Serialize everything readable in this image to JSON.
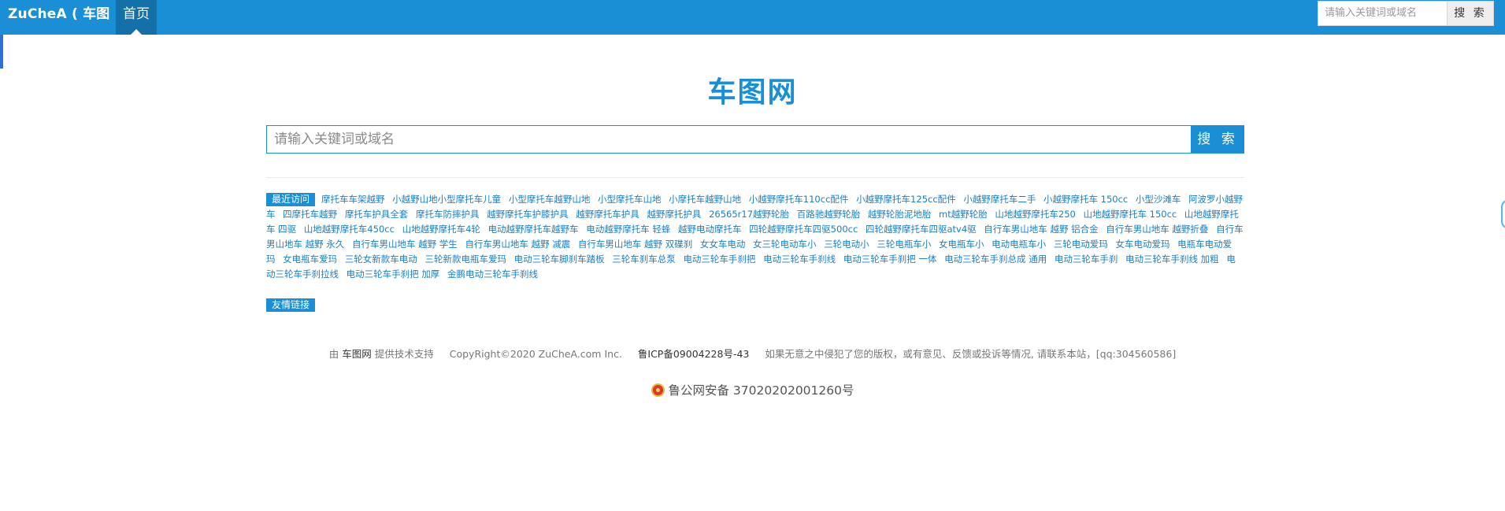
{
  "navbar": {
    "brand": "ZuCheA ( 车图 )",
    "home_label": "首页",
    "search_placeholder": "请输入关键词或域名",
    "search_button": "搜 索"
  },
  "main": {
    "title": "车图网",
    "search_placeholder": "请输入关键词或域名",
    "search_button": "搜 索"
  },
  "recent": {
    "label": "最近访问",
    "links": [
      "摩托车车架越野",
      "小越野山地小型摩托车儿童",
      "小型摩托车越野山地",
      "小型摩托车山地",
      "小摩托车越野山地",
      "小越野摩托车110cc配件",
      "小越野摩托车125cc配件",
      "小越野摩托车二手",
      "小越野摩托车 150cc",
      "小型沙滩车",
      "阿波罗小越野车",
      "四摩托车越野",
      "摩托车护具全套",
      "摩托车防摔护具",
      "越野摩托车护膝护具",
      "越野摩托车护具",
      "越野摩托护具",
      "26565r17越野轮胎",
      "百路驰越野轮胎",
      "越野轮胎泥地胎",
      "mt越野轮胎",
      "山地越野摩托车250",
      "山地越野摩托车 150cc",
      "山地越野摩托车 四驱",
      "山地越野摩托车450cc",
      "山地越野摩托车4轮",
      "电动越野摩托车越野车",
      "电动越野摩托车 轻蜂",
      "越野电动摩托车",
      "四轮越野摩托车四驱500cc",
      "四轮越野摩托车四驱atv4驱",
      "自行车男山地车 越野 铝合金",
      "自行车男山地车 越野折叠",
      "自行车男山地车 越野 永久",
      "自行车男山地车 越野 学生",
      "自行车男山地车 越野 减震",
      "自行车男山地车 越野 双碟刹",
      "女女车电动",
      "女三轮电动车小",
      "三轮电动小",
      "三轮电瓶车小",
      "女电瓶车小",
      "电动电瓶车小",
      "三轮电动爱玛",
      "女车电动爱玛",
      "电瓶车电动爱玛",
      "女电瓶车爱玛",
      "三轮女新款车电动",
      "三轮新款电瓶车爱玛",
      "电动三轮车脚刹车踏板",
      "三轮车刹车总泵",
      "电动三轮车手刹把",
      "电动三轮车手刹线",
      "电动三轮车手刹把 一体",
      "电动三轮车手刹总成 通用",
      "电动三轮车手刹",
      "电动三轮车手刹线 加粗",
      "电动三轮车手刹拉线",
      "电动三轮车手刹把 加厚",
      "金鹏电动三轮车手刹线"
    ]
  },
  "friends": {
    "label": "友情链接"
  },
  "footer": {
    "by": "由",
    "site": "车图网",
    "powered": "提供技术支持",
    "copyright": "CopyRight©2020 ZuCheA.com Inc.",
    "icp": "鲁ICP备09004228号-43",
    "notice": "如果无意之中侵犯了您的版权，或有意见、反馈或投诉等情况, 请联系本站，[qq:304560586]",
    "police": "鲁公网安备 37020202001260号"
  },
  "colors": {
    "brand_blue": "#1a8fd5",
    "nav_active": "#1370a8",
    "link": "#1b7fc4"
  }
}
